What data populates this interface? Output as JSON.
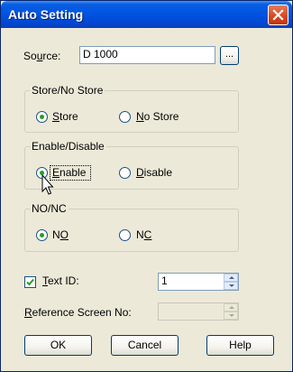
{
  "window": {
    "title": "Auto Setting"
  },
  "source": {
    "label_pre": "So",
    "label_ul": "u",
    "label_post": "rce:",
    "value": "D 1000",
    "browse_label": "..."
  },
  "store_group": {
    "title": "Store/No Store",
    "store_ul": "S",
    "store_rest": "tore",
    "nostore_ul": "N",
    "nostore_rest": "o Store",
    "selected": "Store"
  },
  "enable_group": {
    "title": "Enable/Disable",
    "enable_ul": "E",
    "enable_rest": "nable",
    "disable_ul": "D",
    "disable_rest": "isable",
    "selected": "Enable"
  },
  "nonc_group": {
    "title": "NO/NC",
    "no_pre": "N",
    "no_ul": "O",
    "nc_pre": "N",
    "nc_ul": "C",
    "selected": "NO"
  },
  "text_id": {
    "checked": true,
    "label_ul": "T",
    "label_rest": "ext ID:",
    "value": "1"
  },
  "reference_screen": {
    "label_ul": "R",
    "label_rest": "eference Screen No:",
    "value": "",
    "enabled": false
  },
  "buttons": {
    "ok": "OK",
    "cancel": "Cancel",
    "help": "Help"
  }
}
